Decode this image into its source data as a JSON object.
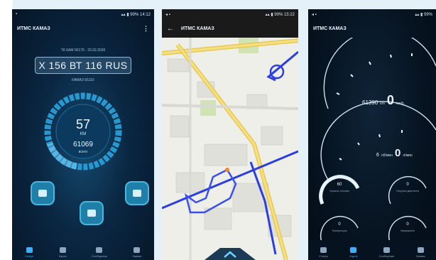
{
  "phone1": {
    "title": "ИТМС КАМАЗ",
    "subtitle_top": "ТК КАМ 00170 · 23.02.2020",
    "plate": "Х 156 ВТ 116 RUS",
    "subtitle_bottom": "КАМАЗ 65115",
    "speed_value": "57",
    "speed_unit": "КМ",
    "odometer_value": "61069",
    "odometer_unit": "всего",
    "nav": [
      "Статус",
      "Карта",
      "Сообщения",
      "Заявки"
    ]
  },
  "phone2": {
    "title": "ИТМС КАМАЗ"
  },
  "phone3": {
    "title": "ИТМС КАМАЗ",
    "gauge1_left": "61390",
    "gauge1_unit1": "km",
    "gauge1_value": "0",
    "gauge1_unit2": "km/h",
    "gauge2_left": "6",
    "gauge2_unit1": "об/мин",
    "gauge2_value": "0",
    "gauge2_unit2": "л/мин",
    "mini": [
      {
        "value": "60",
        "label": "Уровень топлива"
      },
      {
        "value": "0",
        "label": "Нагрузка двигателя"
      },
      {
        "value": "0",
        "label": "Температура"
      },
      {
        "value": "0",
        "label": "Напряжение"
      }
    ],
    "nav": [
      "Статус",
      "Карта",
      "Сообщения",
      "Заявки"
    ]
  }
}
